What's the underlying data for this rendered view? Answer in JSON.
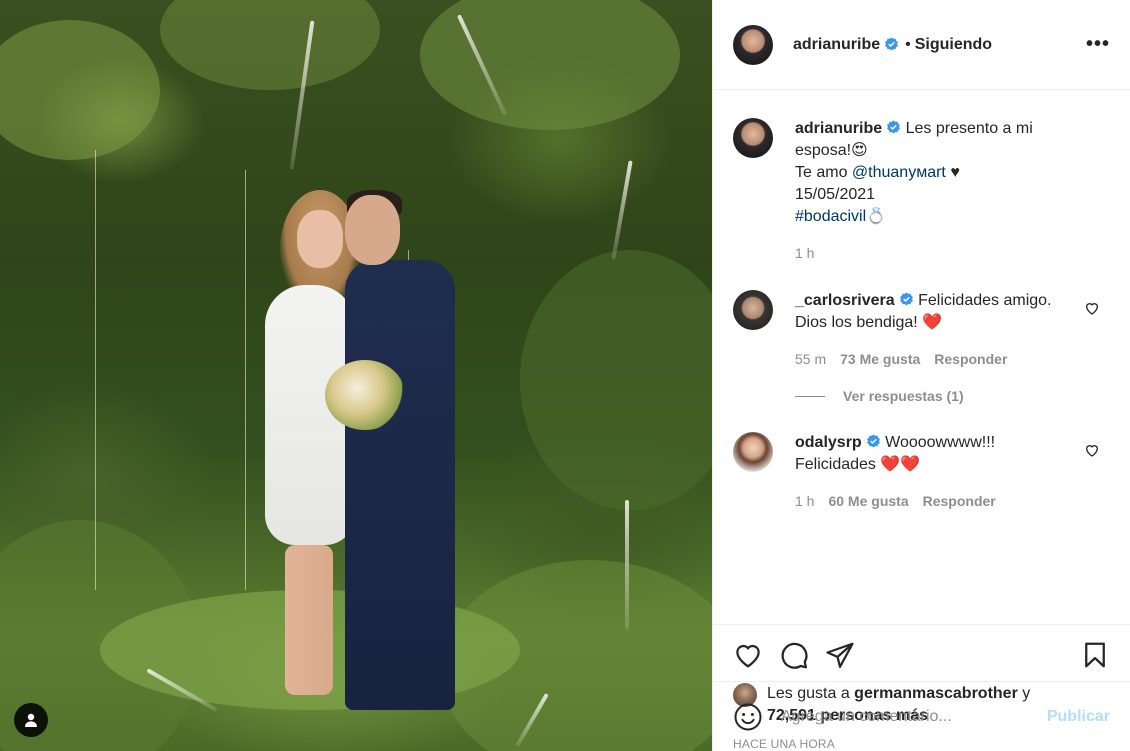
{
  "header": {
    "username": "adrianuribe",
    "separator": "•",
    "follow_status": "Siguiendo",
    "more_label": "•••"
  },
  "caption": {
    "username": "adrianuribe",
    "line1": "Les presento a mi esposa!😍",
    "line2_prefix": "Te amo ",
    "mention": "@thuanyмart",
    "line2_suffix": " ♥",
    "date": "15/05/2021",
    "hashtag": "#bodacivil",
    "hashtag_emoji": "💍",
    "time": "1 h"
  },
  "comments": [
    {
      "username": "_carlosrivera",
      "text": "Felicidades amigo. Dios los bendiga! ❤️",
      "time": "55 m",
      "likes": "73 Me gusta",
      "reply": "Responder",
      "view_replies": "Ver respuestas (1)"
    },
    {
      "username": "odalysrp",
      "text": "Wooooww​ww!!! Felicidades ❤️❤️",
      "time": "1 h",
      "likes": "60 Me gusta",
      "reply": "Responder"
    }
  ],
  "likes": {
    "prefix": "Les gusta a ",
    "user": "germanmascabrother",
    "mid": " y",
    "count": "72,591 personas más"
  },
  "posted": "HACE UNA HORA",
  "add_comment": {
    "placeholder": "Agrega un comentario...",
    "publish": "Publicar"
  },
  "icons": {
    "like": "heart-icon",
    "comment": "comment-icon",
    "share": "share-icon",
    "save": "bookmark-icon",
    "emoji": "smiley-icon",
    "tag": "user-tag-icon",
    "verified": "verified-badge-icon"
  },
  "colors": {
    "verified": "#3897f0",
    "link": "#00376b",
    "muted": "#8e8e8e",
    "publish_disabled": "#b2dffc",
    "heart_red": "#ed4956"
  }
}
